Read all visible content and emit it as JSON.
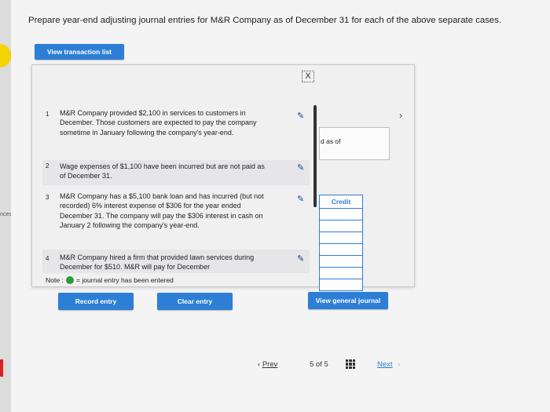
{
  "heading": "Prepare year-end adjusting journal entries for M&R Company as of December 31 for each of the above separate cases.",
  "side_label": "nces",
  "buttons": {
    "view_transaction_list": "View transaction list",
    "record_entry": "Record entry",
    "clear_entry": "Clear entry",
    "view_general_journal": "View general journal"
  },
  "close_symbol": "X",
  "transactions": [
    {
      "num": "1",
      "text": "M&R Company provided $2,100 in services to customers in December. Those customers are expected to pay the company sometime in January following the company's year-end."
    },
    {
      "num": "2",
      "text": "Wage expenses of $1,100 have been incurred but are not paid as of December 31."
    },
    {
      "num": "3",
      "text": "M&R Company has a $5,100 bank loan and has incurred (but not recorded) 6% interest expense of $306 for the year ended December 31. The company will pay the $306 interest in cash on January 2 following the company's year-end."
    },
    {
      "num": "4",
      "text": "M&R Company hired a firm that provided lawn services during December for $510. M&R will pay for December"
    }
  ],
  "journal_text": "d as of",
  "credit_header": "Credit",
  "note": {
    "prefix": "Note :",
    "suffix": "= journal entry has been entered"
  },
  "pagination": {
    "prev": "Prev",
    "page_info": "5 of 5",
    "next": "Next"
  },
  "colors": {
    "accent": "#2d7fd6",
    "entered_dot": "#2e9a3a",
    "side_tab": "#f5d300"
  }
}
